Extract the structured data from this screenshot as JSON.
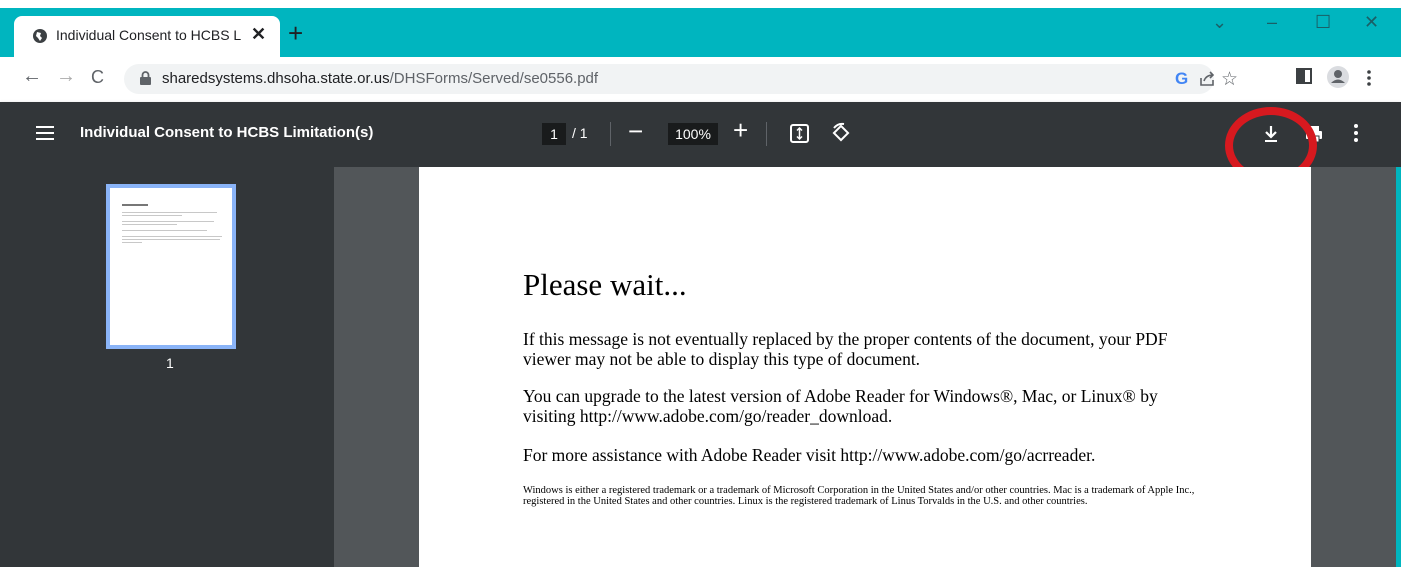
{
  "browser": {
    "tab_title": "Individual Consent to HCBS Limit",
    "tab_close": "✕",
    "new_tab": "+",
    "url_host": "sharedsystems.dhsoha.state.or.us",
    "url_path": "/DHSForms/Served/se0556.pdf",
    "window_controls": {
      "dropdown": "⌄",
      "minimize": "–",
      "maximize": "☐",
      "close": "✕"
    },
    "nav": {
      "back": "←",
      "forward": "→",
      "reload": "C"
    },
    "colors": {
      "frame": "#00b5bf",
      "toolbar": "#ffffff",
      "omnibox": "#f1f3f4"
    }
  },
  "pdf_viewer": {
    "title": "Individual Consent to HCBS Limitation(s)",
    "page_current": "1",
    "page_total": "/ 1",
    "zoom": "100%",
    "zoom_minus": "−",
    "zoom_plus": "+",
    "thumbnail_label": "1",
    "colors": {
      "toolbar": "#323639",
      "canvas": "#525659",
      "thumb_border": "#8ab4f8"
    }
  },
  "annotation": {
    "color": "#d7191f"
  },
  "document": {
    "heading": "Please wait...",
    "para1": "If this message is not eventually replaced by the proper contents of the document, your PDF viewer may not be able to display this type of document.",
    "para2": "You can upgrade to the latest version of Adobe Reader for Windows®, Mac, or Linux® by visiting  http://www.adobe.com/go/reader_download.",
    "para3": "For more assistance with Adobe Reader visit  http://www.adobe.com/go/acrreader.",
    "fine_print": "Windows is either a registered trademark or a trademark of Microsoft Corporation in the United States and/or other countries. Mac is a trademark of Apple Inc., registered in the United States and other countries. Linux is the registered trademark of Linus Torvalds in the U.S. and other countries."
  }
}
